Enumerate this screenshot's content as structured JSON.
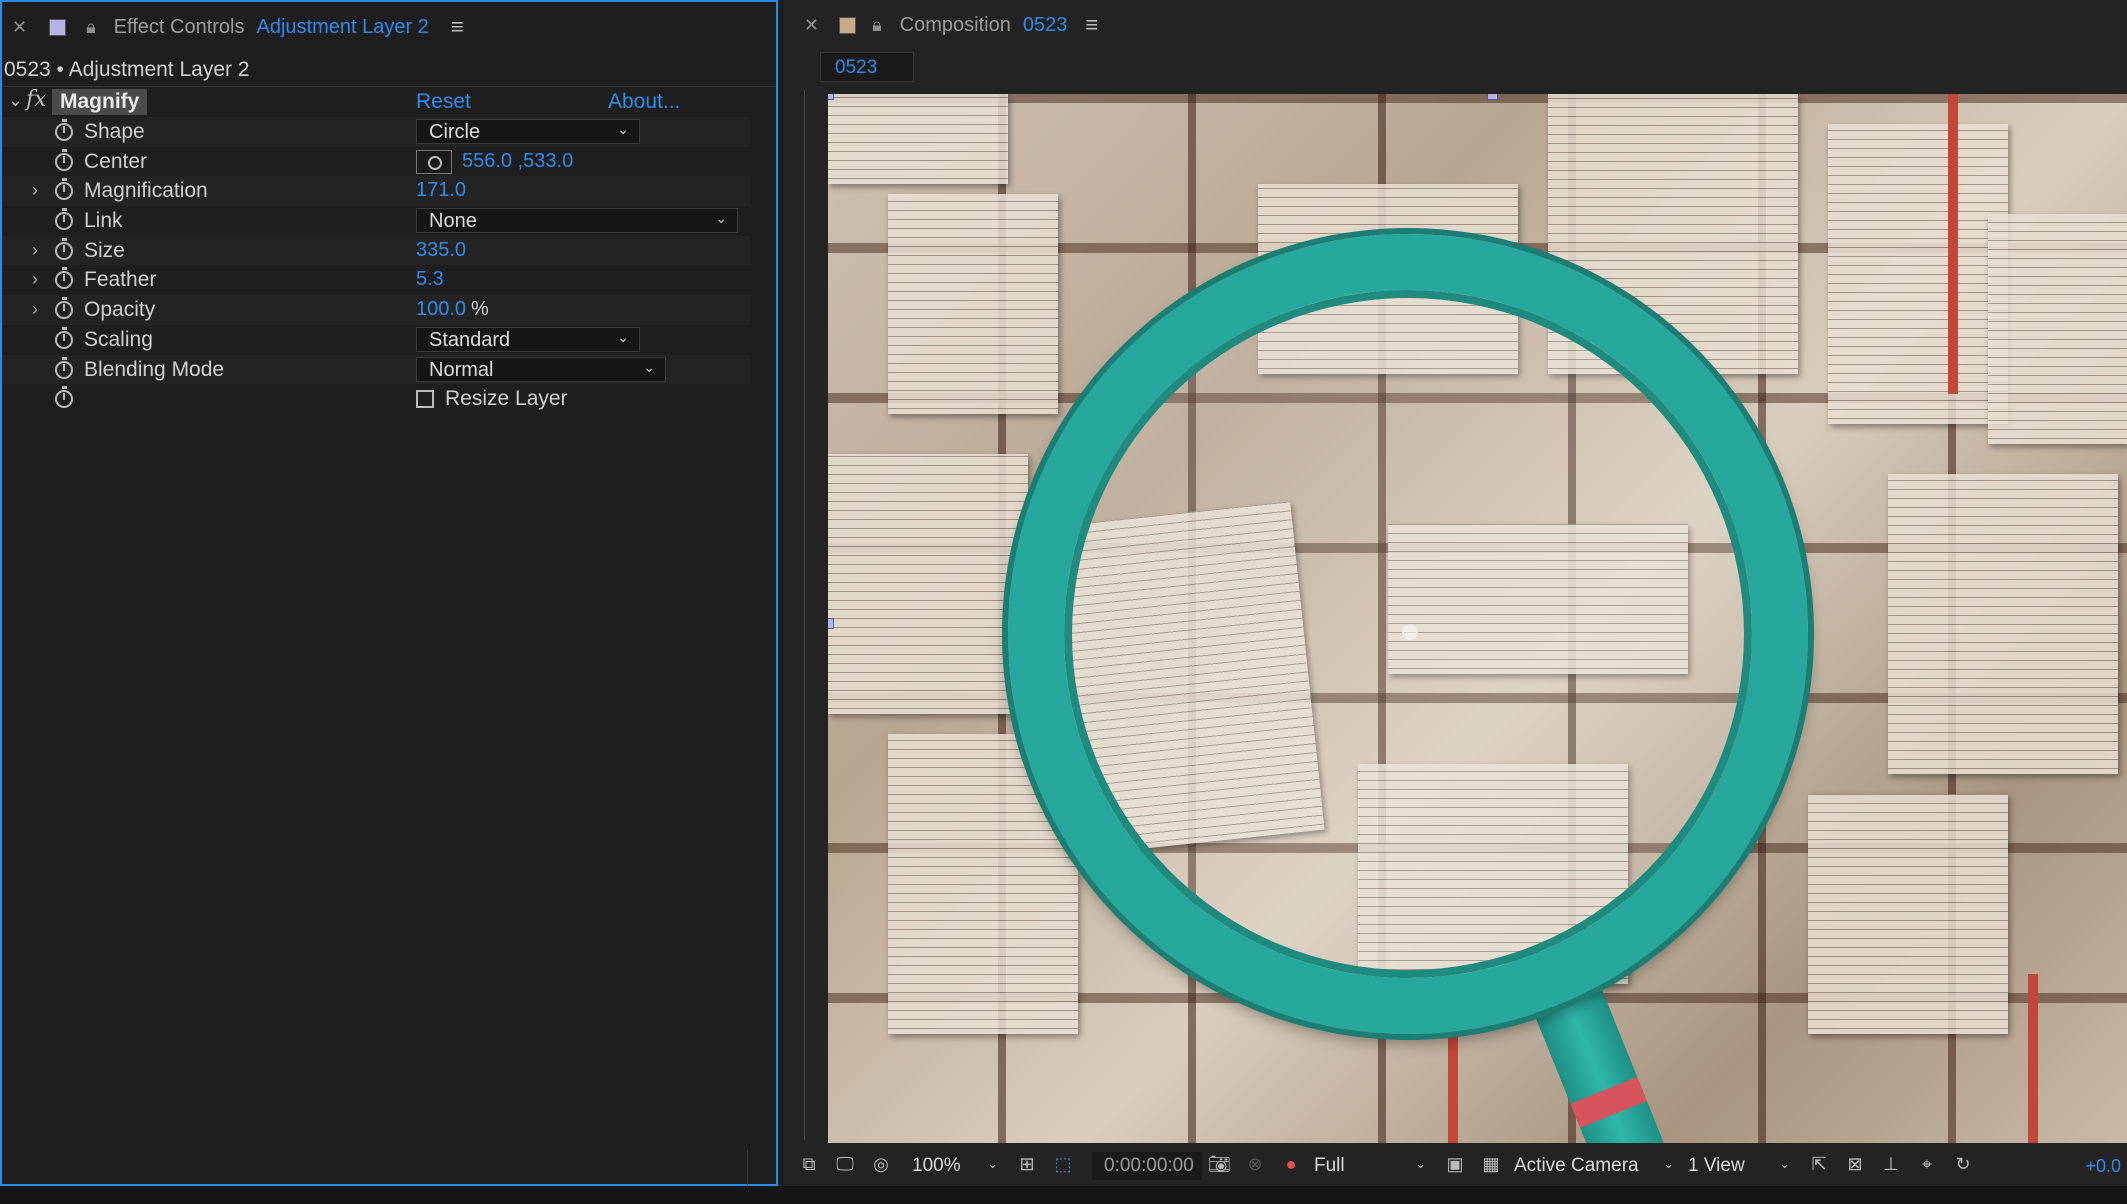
{
  "effect_controls": {
    "tab_label": "Effect Controls",
    "tab_layer": "Adjustment Layer 2",
    "subtitle": "0523 • Adjustment Layer 2",
    "effect_name": "Magnify",
    "reset": "Reset",
    "about": "About...",
    "props": {
      "shape": {
        "label": "Shape",
        "value": "Circle"
      },
      "center": {
        "label": "Center",
        "value": "556.0 ,533.0"
      },
      "magnification": {
        "label": "Magnification",
        "value": "171.0"
      },
      "link": {
        "label": "Link",
        "value": "None"
      },
      "size": {
        "label": "Size",
        "value": "335.0"
      },
      "feather": {
        "label": "Feather",
        "value": "5.3"
      },
      "opacity": {
        "label": "Opacity",
        "value": "100.0",
        "unit": "%"
      },
      "scaling": {
        "label": "Scaling",
        "value": "Standard"
      },
      "blending": {
        "label": "Blending Mode",
        "value": "Normal"
      },
      "resize": {
        "label": "Resize Layer",
        "checked": false
      }
    }
  },
  "composition": {
    "tab_label": "Composition",
    "tab_comp": "0523",
    "comp_tab": "0523",
    "toolbar": {
      "zoom": "100%",
      "timecode": "0:00:00:00",
      "resolution": "Full",
      "camera": "Active Camera",
      "views": "1 View",
      "exposure": "+0.0"
    }
  },
  "colors": {
    "accent": "#2d8ceb",
    "panel_bg": "#1e1e1e",
    "lens": "#27a89c"
  }
}
